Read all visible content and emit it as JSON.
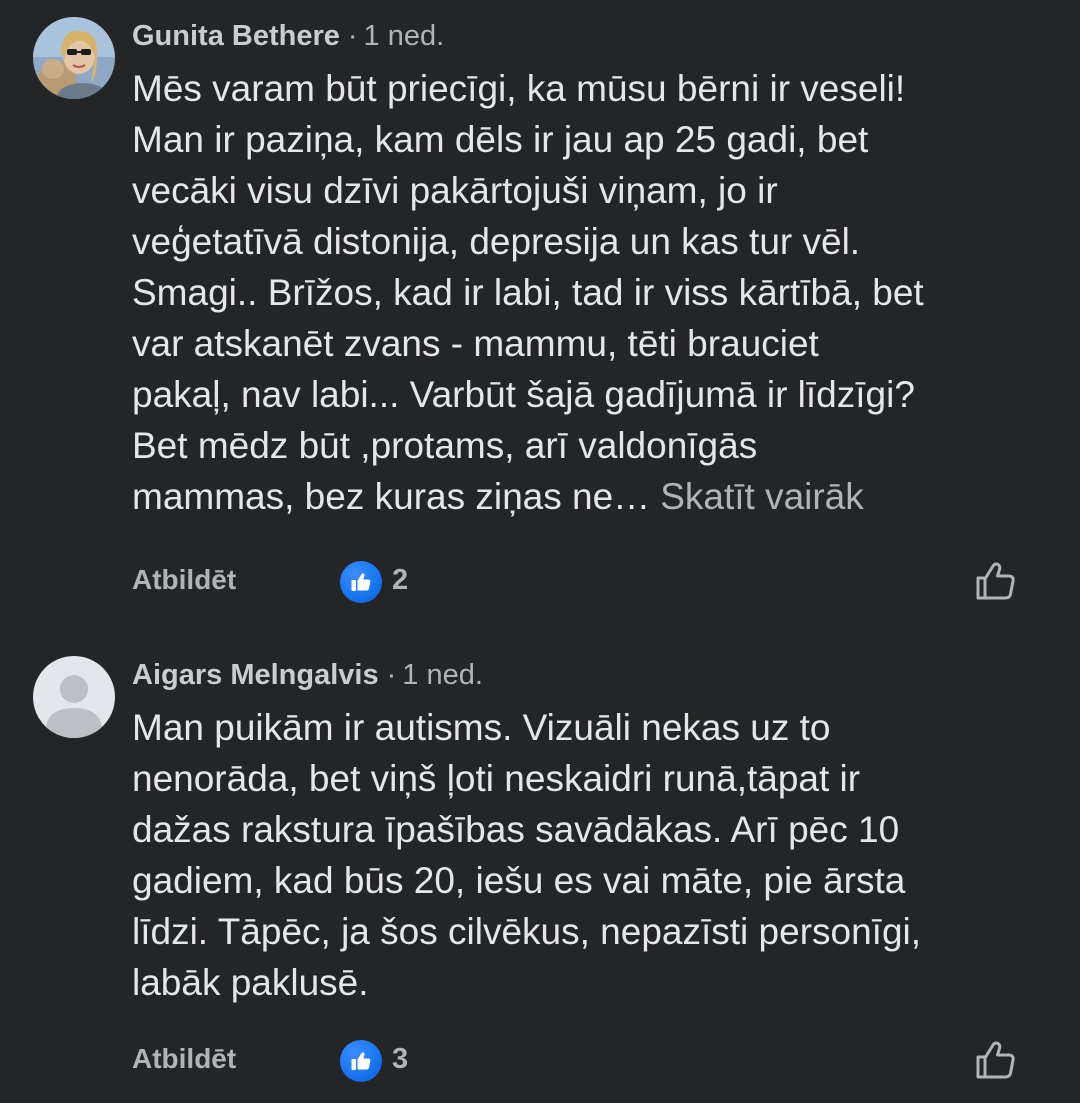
{
  "comments": [
    {
      "author": "Gunita Bethere",
      "separator": "·",
      "time": "1 ned.",
      "body_lines": [
        "Mēs varam būt priecīgi, ka mūsu bērni ir veseli!",
        "Man ir paziņa, kam dēls ir jau ap 25 gadi, bet",
        "vecāki visu dzīvi pakārtojuši viņam, jo ir",
        "veģetatīvā distonija, depresija un kas tur vēl.",
        "Smagi.. Brīžos, kad ir labi, tad ir viss kārtībā, bet",
        "var atskanēt zvans - mammu, tēti brauciet",
        "pakaļ, nav labi... Varbūt šajā gadījumā ir līdzīgi?",
        "Bet mēdz būt ,protams, arī valdonīgās",
        "mammas, bez kuras ziņas ne…"
      ],
      "see_more": "Skatīt vairāk",
      "reply_label": "Atbildēt",
      "reaction_icon": "like-icon",
      "reaction_count": "2",
      "like_icon": "thumbs-up-outline-icon"
    },
    {
      "author": "Aigars Melngalvis",
      "separator": "·",
      "time": "1 ned.",
      "body_lines": [
        "Man puikām ir autisms. Vizuāli nekas uz to",
        "nenorāda, bet viņš ļoti neskaidri runā,tāpat ir",
        "dažas rakstura īpašības savādākas. Arī pēc 10",
        "gadiem, kad būs 20, iešu es vai māte, pie ārsta",
        "līdzi. Tāpēc, ja šos cilvēkus, nepazīsti personīgi,",
        "labāk paklusē."
      ],
      "reply_label": "Atbildēt",
      "reaction_icon": "like-icon",
      "reaction_count": "3",
      "like_icon": "thumbs-up-outline-icon"
    }
  ],
  "colors": {
    "background": "#242526",
    "text_primary": "#e4e6eb",
    "text_secondary": "#b0b3b8",
    "like_blue": "#1877f2"
  }
}
